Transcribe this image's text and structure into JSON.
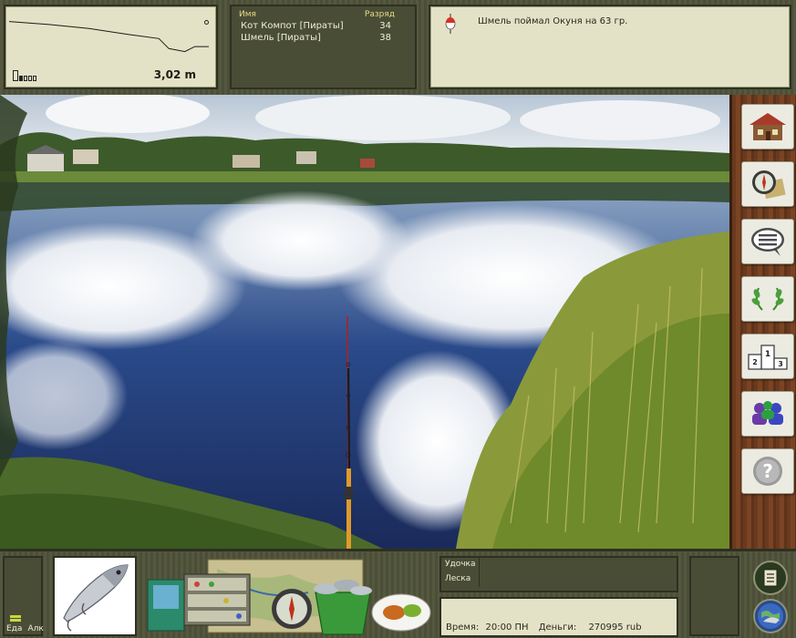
{
  "depth": {
    "value": "3,02 m",
    "battery_level": 0.2,
    "profile_points": [
      [
        0,
        0.12
      ],
      [
        0.2,
        0.18
      ],
      [
        0.4,
        0.26
      ],
      [
        0.6,
        0.38
      ],
      [
        0.75,
        0.46
      ],
      [
        0.8,
        0.66
      ],
      [
        0.88,
        0.72
      ],
      [
        0.93,
        0.62
      ],
      [
        1.0,
        0.62
      ]
    ]
  },
  "players": {
    "header_name": "Имя",
    "header_rank": "Разряд",
    "rows": [
      {
        "name": "Кот Компот [Пираты]",
        "rank": "34"
      },
      {
        "name": "Шмель [Пираты]",
        "rank": "38"
      }
    ]
  },
  "message": {
    "text": "Шмель поймал Окуня на 63 гр."
  },
  "sidebar": {
    "items": [
      {
        "icon": "house-icon"
      },
      {
        "icon": "compass-map-icon"
      },
      {
        "icon": "chat-icon"
      },
      {
        "icon": "laurel-icon"
      },
      {
        "icon": "podium-icon"
      },
      {
        "icon": "people-icon"
      },
      {
        "icon": "help-icon"
      }
    ],
    "podium_1": "1",
    "podium_2": "2",
    "podium_3": "3",
    "help_glyph": "?"
  },
  "meter": {
    "food_label": "Еда",
    "alc_label": "Алк",
    "level": 0.3
  },
  "tackle": {
    "rod_label": "Удочка",
    "line_label": "Леска"
  },
  "status": {
    "time_label": "Время:",
    "time_value": "20:00 ПН",
    "money_label": "Деньги:",
    "money_value": "270995 rub"
  },
  "colors": {
    "panel_dark": "#4a4d35",
    "panel_cream": "#e4e2c6",
    "accent_yellow": "#e6dc88"
  }
}
